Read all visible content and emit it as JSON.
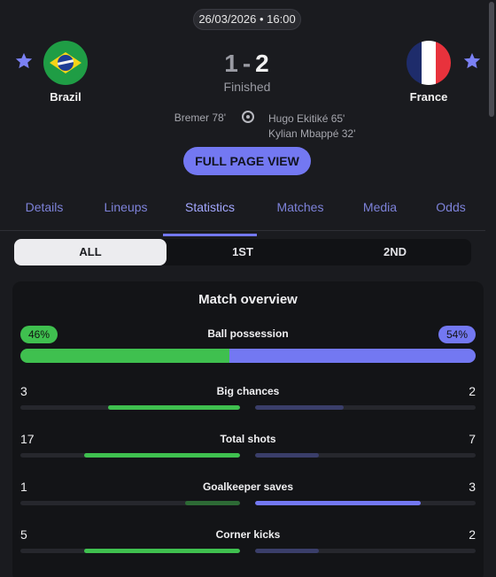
{
  "match": {
    "datetime": "26/03/2026 • 16:00",
    "home": {
      "name": "Brazil",
      "score": "1"
    },
    "away": {
      "name": "France",
      "score": "2"
    },
    "score_separator": "-",
    "status": "Finished",
    "home_scorers": [
      "Bremer 78'"
    ],
    "away_scorers": [
      "Hugo Ekitiké 65'",
      "Kylian Mbappé 32'"
    ],
    "full_page_label": "FULL PAGE VIEW"
  },
  "tabs": [
    {
      "label": "Details",
      "active": false
    },
    {
      "label": "Lineups",
      "active": false
    },
    {
      "label": "Statistics",
      "active": true
    },
    {
      "label": "Matches",
      "active": false
    },
    {
      "label": "Media",
      "active": false
    },
    {
      "label": "Odds",
      "active": false
    }
  ],
  "periods": [
    {
      "label": "ALL",
      "active": true
    },
    {
      "label": "1ST",
      "active": false
    },
    {
      "label": "2ND",
      "active": false
    }
  ],
  "overview": {
    "title": "Match overview",
    "possession": {
      "label": "Ball possession",
      "home": "46%",
      "away": "54%",
      "home_fraction": 0.46
    },
    "stats": [
      {
        "label": "Big chances",
        "home": "3",
        "away": "2",
        "home_fraction": 0.6,
        "away_fraction": 0.4,
        "leader": "home"
      },
      {
        "label": "Total shots",
        "home": "17",
        "away": "7",
        "home_fraction": 0.71,
        "away_fraction": 0.29,
        "leader": "home"
      },
      {
        "label": "Goalkeeper saves",
        "home": "1",
        "away": "3",
        "home_fraction": 0.25,
        "away_fraction": 0.75,
        "leader": "away"
      },
      {
        "label": "Corner kicks",
        "home": "5",
        "away": "2",
        "home_fraction": 0.71,
        "away_fraction": 0.29,
        "leader": "home"
      }
    ]
  },
  "colors": {
    "accent": "#7378f2",
    "home_strong": "#3fc04f",
    "home_weak": "#2d6a35",
    "away_strong": "#7378f2",
    "away_weak": "#3a3e6a",
    "brazil_green": "#1f9d45",
    "brazil_yellow": "#f7d417",
    "france_blue": "#1e2c6b",
    "france_white": "#ffffff",
    "france_red": "#e8323c"
  },
  "icons": {
    "favorite": "star-icon",
    "goal": "football-icon"
  }
}
